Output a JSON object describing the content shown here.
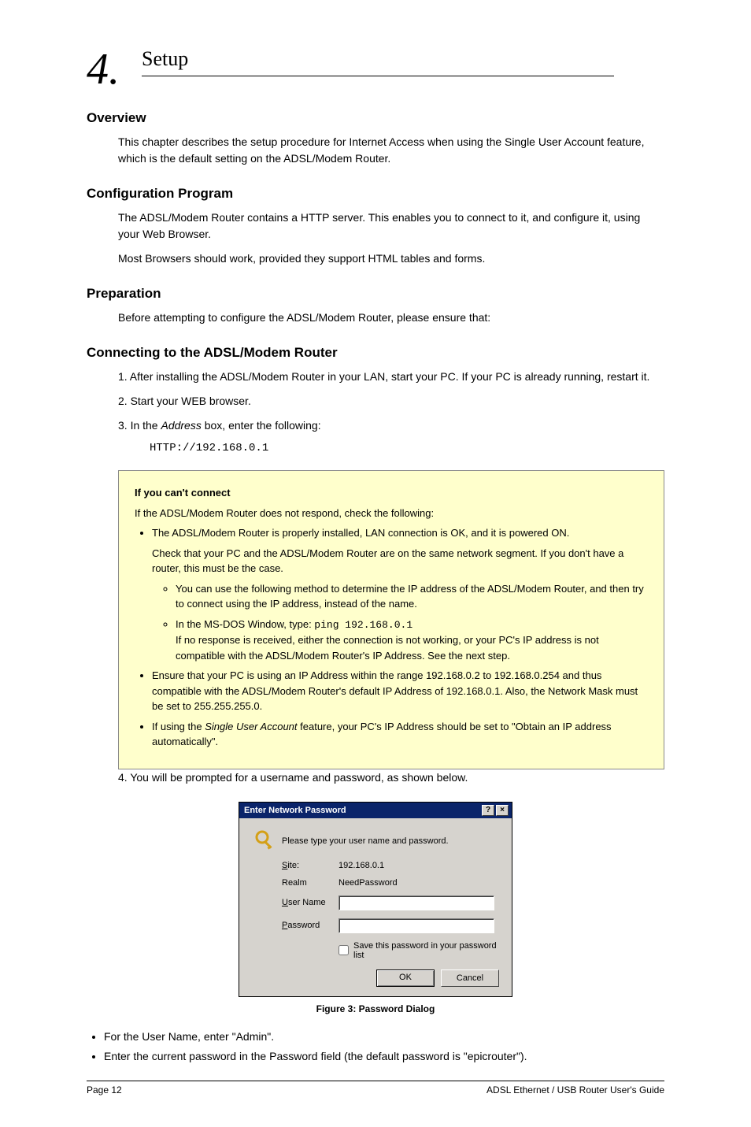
{
  "heading_number": "4.",
  "header_text": "Setup",
  "section_title": "Setup",
  "overview_title": "Overview",
  "overview_para": "This chapter describes the setup procedure for Internet Access when using the Single User Account feature, which is the default setting on the ADSL/Modem Router.",
  "config_title": "Configuration Program",
  "config_para1": "The ADSL/Modem Router contains a HTTP server. This enables you to connect to it, and configure it, using your Web Browser.",
  "config_para2": "Most Browsers should work, provided they support HTML tables and forms.",
  "preparation_title": "Preparation",
  "preparation_para": "Before attempting to configure the ADSL/Modem Router, please ensure that:",
  "connect_title": "Connecting to the ADSL/Modem Router",
  "step1": "1. After installing the ADSL/Modem Router in your LAN, start your PC. If your PC is already running, restart it.",
  "step2": "2. Start your WEB browser.",
  "step3_prefix": "3. In the ",
  "step3_italic": "Address",
  "step3_rest": " box, enter the following:",
  "url": "HTTP://192.168.0.1",
  "tip_title": "If you can't connect",
  "tip_intro": "If the ADSL/Modem Router does not respond, check the following:",
  "tip_b1": "The ADSL/Modem Router is properly installed, LAN connection is OK, and it is powered ON.",
  "tip_b1a": "Check that your PC and the ADSL/Modem Router are on the same network segment. If you don't have a router, this must be the case.",
  "tip_sub1": "You can use the following method to determine the IP address of the ADSL/Modem Router, and then try to connect using the IP address, instead of the name.",
  "tip_sub2_prefix": "In the MS-DOS Window, type: ",
  "tip_sub2_cmd": "ping 192.168.0.1",
  "tip_sub2_rest": " If no response is received, either the connection is not working, or your PC's IP address is not compatible with the ADSL/Modem Router's IP Address. See the next step.",
  "tip_b2": "Ensure that your PC is using an IP Address within the range 192.168.0.2 to 192.168.0.254 and thus compatible with the ADSL/Modem Router's default IP Address of 192.168.0.1. Also, the Network Mask must be set to 255.255.255.0.",
  "tip_b3_prefix": "If using the ",
  "tip_b3_italic": "Single User Account",
  "tip_b3_rest": " feature, your PC's IP Address should be set to \"Obtain an IP address automatically\".",
  "prompt_para": "4. You will be prompted for a username and password, as shown below.",
  "dialog": {
    "title": "Enter Network Password",
    "instruction": "Please type your user name and password.",
    "site_label_u": "S",
    "site_label_rest": "ite:",
    "site_value": "192.168.0.1",
    "realm_label": "Realm",
    "realm_value": "NeedPassword",
    "user_label_u": "U",
    "user_label_rest": "ser Name",
    "pass_label_u": "P",
    "pass_label_rest": "assword",
    "save_u": "S",
    "save_rest": "ave this password in your password list",
    "ok": "OK",
    "cancel": "Cancel"
  },
  "figure_caption": "Figure 3: Password Dialog",
  "outer_li1": "For the User Name, enter \"Admin\".",
  "outer_li2": "Enter the current password in the Password field (the default password is \"epicrouter\").",
  "footer_left": "Page 12",
  "footer_right": "ADSL Ethernet / USB Router User's Guide"
}
